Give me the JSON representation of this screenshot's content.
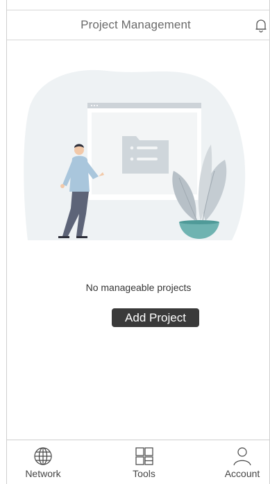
{
  "header": {
    "title": "Project Management",
    "notification_icon": "bell-icon"
  },
  "empty_state": {
    "illustration": "person-presenting-folder-with-plant",
    "message": "No manageable projects",
    "add_button_label": "Add Project"
  },
  "tabbar": {
    "tabs": [
      {
        "label": "Network",
        "icon": "globe-icon"
      },
      {
        "label": "Tools",
        "icon": "grid-icon"
      },
      {
        "label": "Account",
        "icon": "person-icon"
      }
    ]
  },
  "colors": {
    "button_bg": "#3a3a3a",
    "button_text": "#ffffff",
    "illustration_bg": "#eef2f4",
    "accent_teal": "#6fb3b1"
  }
}
